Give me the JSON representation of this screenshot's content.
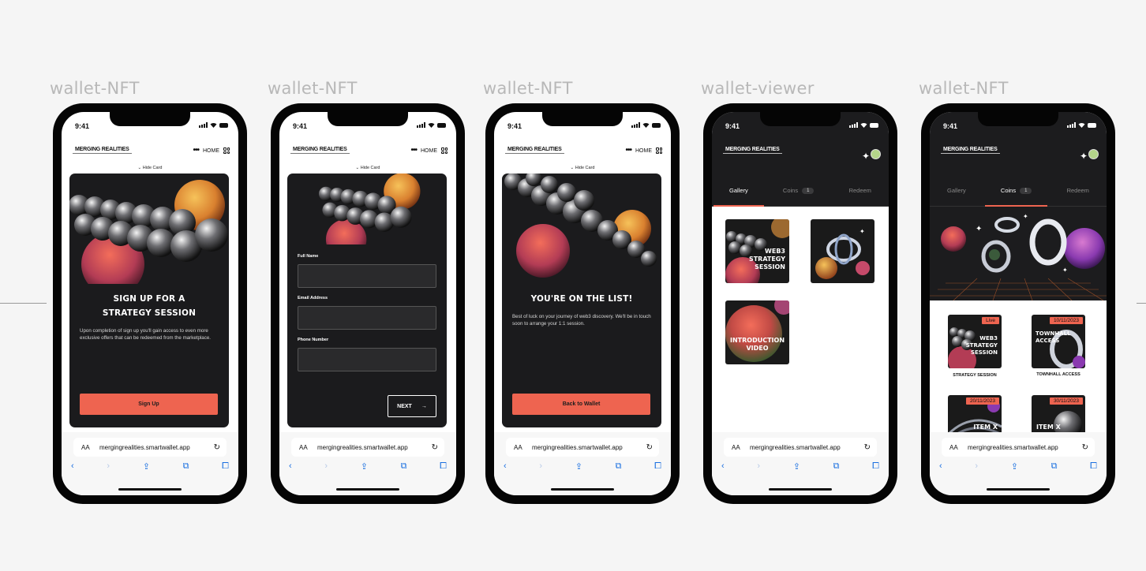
{
  "phones": [
    {
      "label": "wallet-NFT"
    },
    {
      "label": "wallet-NFT"
    },
    {
      "label": "wallet-NFT"
    },
    {
      "label": "wallet-viewer"
    },
    {
      "label": "wallet-NFT"
    }
  ],
  "status": {
    "time": "9:41"
  },
  "brand": {
    "logo": "MERGING REALITIES"
  },
  "nav": {
    "home": "HOME",
    "dots": "•••",
    "hide_card": "Hide Card"
  },
  "browser": {
    "aa": "AA",
    "url": "mergingrealities.smartwallet.app"
  },
  "signup": {
    "title_line1": "SIGN UP FOR A",
    "title_line2": "STRATEGY SESSION",
    "body": "Upon completion of sign up you'll gain access to even more exclusive offers that can be redeemed from the marketplace.",
    "button": "Sign Up"
  },
  "form": {
    "full_name_label": "Full Name",
    "email_label": "Email Address",
    "phone_label": "Phone Number",
    "next": "NEXT"
  },
  "confirm": {
    "title": "YOU'RE ON THE LIST!",
    "body": "Best of luck on your journey of web3 discovery. We'll be in touch soon to arrange your 1:1 session.",
    "button": "Back to Wallet"
  },
  "tabs": {
    "gallery": "Gallery",
    "coins": "Coins",
    "coins_count": "1",
    "redeem": "Redeem"
  },
  "gallery": {
    "items": [
      {
        "title": "WEB3\nSTRATEGY\nSESSION"
      },
      {
        "title": ""
      },
      {
        "title": "INTRODUCTION\nVIDEO"
      }
    ]
  },
  "coins": {
    "items": [
      {
        "badge": "Live",
        "title": "WEB3\nSTRATEGY\nSESSION",
        "caption": "STRATEGY SESSION"
      },
      {
        "badge": "10/11/2023",
        "title": "TOWNHALL\nACCESS",
        "caption": "TOWNHALL ACCESS"
      },
      {
        "badge": "20/11/2023",
        "title": "ITEM X",
        "caption": ""
      },
      {
        "badge": "30/11/2023",
        "title": "ITEM X",
        "caption": ""
      }
    ]
  },
  "colors": {
    "accent": "#ee6450",
    "card": "#1b1b1d",
    "link_blue": "#1a6fe0"
  }
}
